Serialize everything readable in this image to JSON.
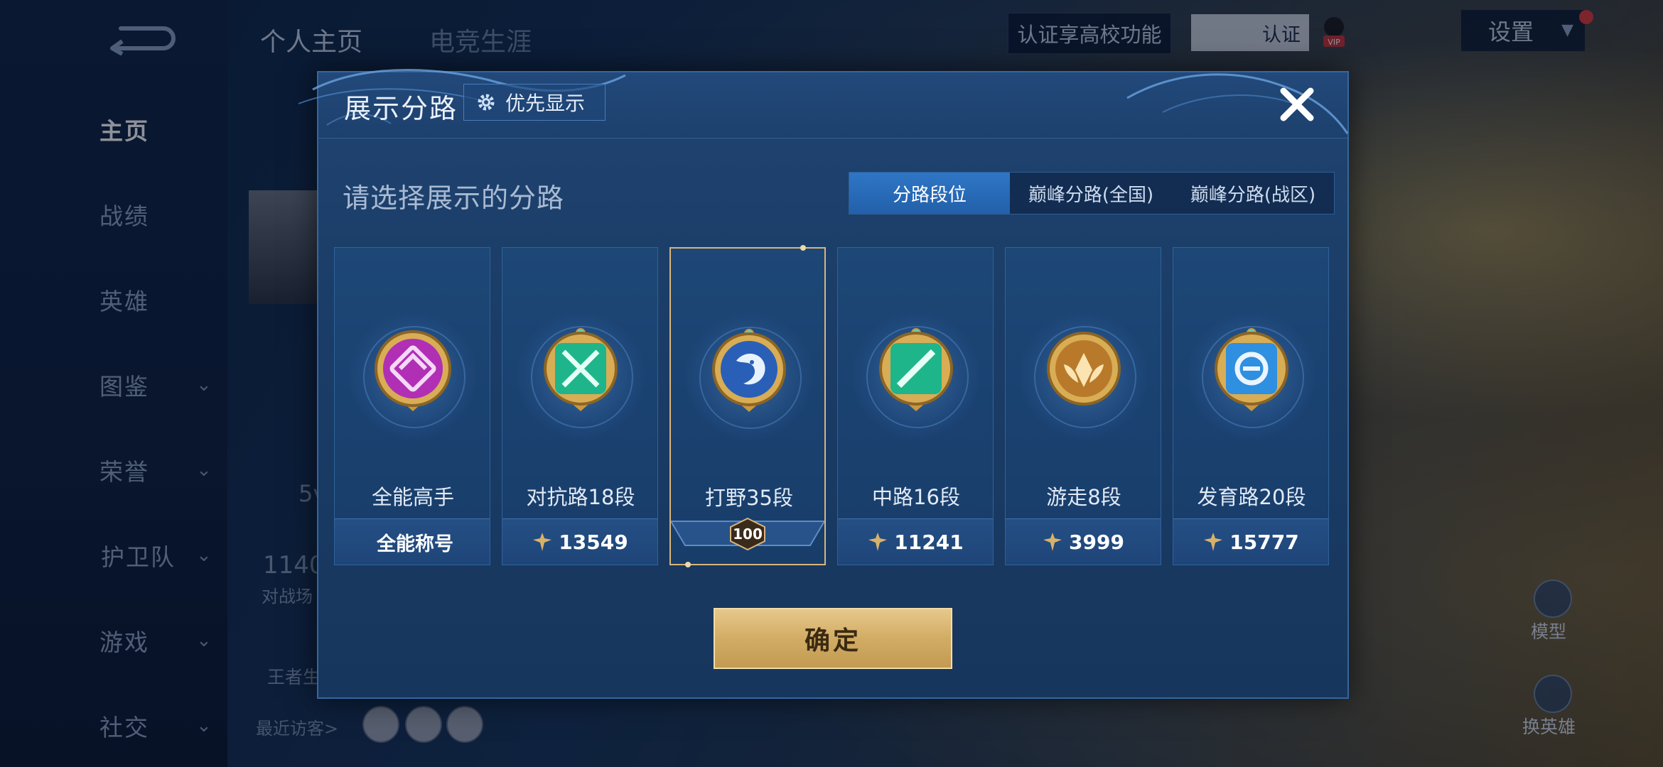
{
  "top_tabs": {
    "profile": "个人主页",
    "esports": "电竞生涯"
  },
  "nav": [
    {
      "label": "主页",
      "active": true,
      "has_chevron": false
    },
    {
      "label": "战绩",
      "active": false,
      "has_chevron": false
    },
    {
      "label": "英雄",
      "active": false,
      "has_chevron": false
    },
    {
      "label": "图鉴",
      "active": false,
      "has_chevron": true
    },
    {
      "label": "荣誉",
      "active": false,
      "has_chevron": true
    },
    {
      "label": "护卫队",
      "active": false,
      "has_chevron": true
    },
    {
      "label": "游戏",
      "active": false,
      "has_chevron": true
    },
    {
      "label": "社交",
      "active": false,
      "has_chevron": true
    }
  ],
  "header_right": {
    "certify_text": "认证享高校功能",
    "certify_button": "认证",
    "settings": "设置"
  },
  "background": {
    "frag_count": "1140",
    "frag_label": "对战场",
    "frag_mode": "5v",
    "frag_level": "王者生",
    "recent_visitors": "最近访客>",
    "model": "模型",
    "switch_hero": "换英雄"
  },
  "dialog": {
    "title": "展示分路",
    "priority_button": "优先显示",
    "subtitle": "请选择展示的分路",
    "tabs": [
      {
        "label": "分路段位",
        "active": true
      },
      {
        "label": "巅峰分路(全国)",
        "active": false
      },
      {
        "label": "巅峰分路(战区)",
        "active": false
      }
    ],
    "cards": [
      {
        "name": "全能高手",
        "footer": "全能称号",
        "footer_icon": false,
        "selected": false,
        "emblem_color": "#b02fb5",
        "emblem_icon": "all-round-emblem-icon"
      },
      {
        "name": "对抗路18段",
        "footer": "13549",
        "footer_icon": true,
        "selected": false,
        "emblem_color": "#1fb58a",
        "emblem_icon": "clash-lane-emblem-icon"
      },
      {
        "name": "打野35段",
        "footer": "100",
        "footer_icon": false,
        "selected": true,
        "emblem_color": "#2a5fb8",
        "emblem_icon": "jungle-emblem-icon"
      },
      {
        "name": "中路16段",
        "footer": "11241",
        "footer_icon": true,
        "selected": false,
        "emblem_color": "#1fb58a",
        "emblem_icon": "mid-lane-emblem-icon"
      },
      {
        "name": "游走8段",
        "footer": "3999",
        "footer_icon": true,
        "selected": false,
        "emblem_color": "#d9a24a",
        "emblem_icon": "roam-emblem-icon"
      },
      {
        "name": "发育路20段",
        "footer": "15777",
        "footer_icon": true,
        "selected": false,
        "emblem_color": "#2f8fe0",
        "emblem_icon": "farm-lane-emblem-icon"
      }
    ],
    "confirm": "确定"
  },
  "colors": {
    "accent_blue": "#2f76c6",
    "gold": "#d2ac65",
    "selected_border": "#d9b57a"
  }
}
